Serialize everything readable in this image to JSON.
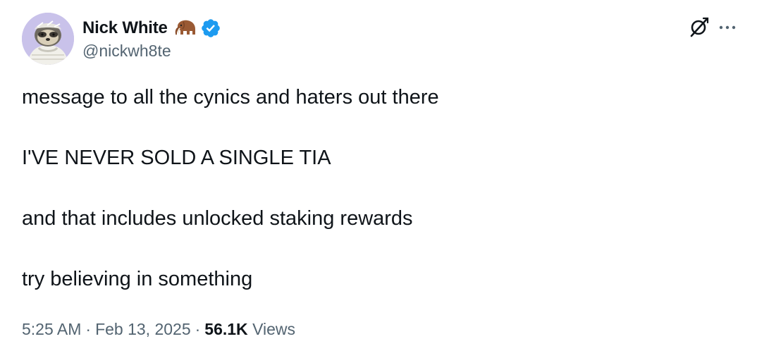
{
  "author": {
    "display_name": "Nick White",
    "handle": "@nickwh8te",
    "emoji_badge": "mammoth-emoji",
    "verified": true,
    "verified_color": "#1d9bf0"
  },
  "tweet": {
    "lines": [
      "message to all the cynics and haters out there",
      "I'VE NEVER SOLD A SINGLE TIA",
      "and that includes unlocked staking rewards",
      "try believing in something"
    ]
  },
  "meta": {
    "time": "5:25 AM",
    "separator": "·",
    "date": "Feb 13, 2025",
    "views_count": "56.1K",
    "views_label": "Views"
  },
  "icons": {
    "grok": "grok-icon",
    "more": "more-options-icon"
  },
  "colors": {
    "text": "#0f1419",
    "secondary": "#536471",
    "avatar_bg": "#c9c2ea"
  }
}
